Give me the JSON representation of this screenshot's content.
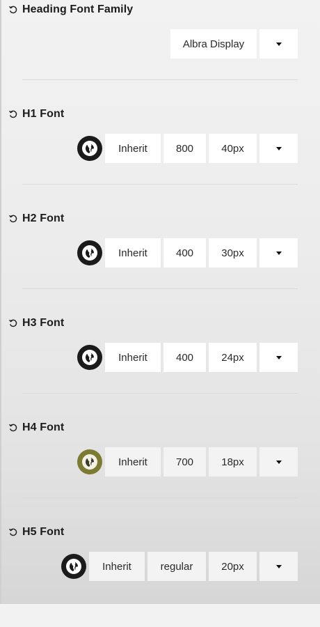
{
  "heading_family": {
    "label": "Heading Font Family",
    "value": "Albra Display"
  },
  "fonts": [
    {
      "label": "H1 Font",
      "family": "Inherit",
      "weight": "800",
      "size": "40px",
      "globe_active": false
    },
    {
      "label": "H2 Font",
      "family": "Inherit",
      "weight": "400",
      "size": "30px",
      "globe_active": false
    },
    {
      "label": "H3 Font",
      "family": "Inherit",
      "weight": "400",
      "size": "24px",
      "globe_active": false
    },
    {
      "label": "H4 Font",
      "family": "Inherit",
      "weight": "700",
      "size": "18px",
      "globe_active": true
    },
    {
      "label": "H5 Font",
      "family": "Inherit",
      "weight": "regular",
      "size": "20px",
      "globe_active": false
    }
  ],
  "colors": {
    "globe_default": "#1b1b1b",
    "globe_active": "#7d7a33"
  }
}
